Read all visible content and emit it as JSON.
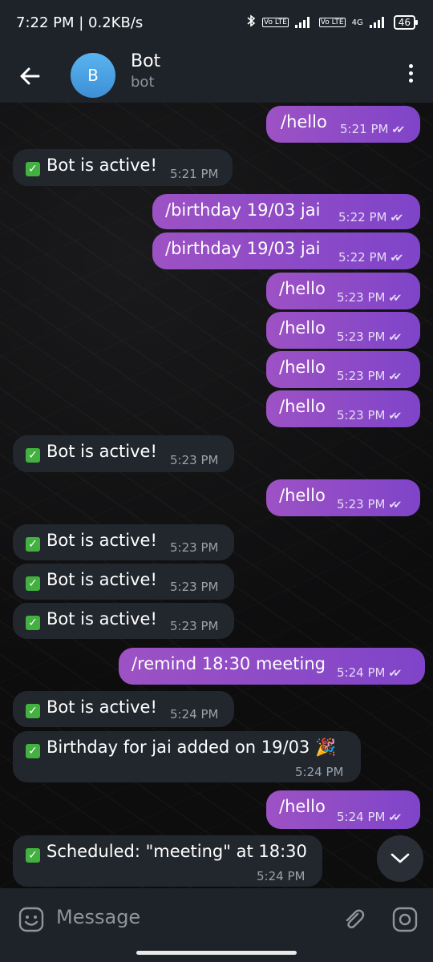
{
  "status_bar": {
    "time": "7:22 PM",
    "speed": "0.2KB/s",
    "net1": "Vo LTE",
    "net2": "Vo LTE",
    "net_type": "4G",
    "battery": "46"
  },
  "header": {
    "avatar_letter": "B",
    "title": "Bot",
    "subtitle": "bot"
  },
  "messages": [
    {
      "dir": "out",
      "text": "/hello",
      "time": "5:21 PM"
    },
    {
      "dir": "in",
      "text": "Bot is active!",
      "time": "5:21 PM"
    },
    {
      "dir": "out",
      "text": "/birthday 19/03 jai",
      "time": "5:22 PM"
    },
    {
      "dir": "out",
      "text": "/birthday 19/03 jai",
      "time": "5:22 PM"
    },
    {
      "dir": "out",
      "text": "/hello",
      "time": "5:23 PM"
    },
    {
      "dir": "out",
      "text": "/hello",
      "time": "5:23 PM"
    },
    {
      "dir": "out",
      "text": "/hello",
      "time": "5:23 PM"
    },
    {
      "dir": "out",
      "text": "/hello",
      "time": "5:23 PM"
    },
    {
      "dir": "in",
      "text": "Bot is active!",
      "time": "5:23 PM"
    },
    {
      "dir": "out",
      "text": "/hello",
      "time": "5:23 PM"
    },
    {
      "dir": "in",
      "text": "Bot is active!",
      "time": "5:23 PM"
    },
    {
      "dir": "in",
      "text": "Bot is active!",
      "time": "5:23 PM"
    },
    {
      "dir": "in",
      "text": "Bot is active!",
      "time": "5:23 PM"
    },
    {
      "dir": "out",
      "text": "/remind 18:30 meeting",
      "time": "5:24 PM"
    },
    {
      "dir": "in",
      "text": "Bot is active!",
      "time": "5:24 PM"
    },
    {
      "dir": "in",
      "text": "Birthday for jai added on 19/03 🎉",
      "time": "5:24 PM"
    },
    {
      "dir": "out",
      "text": "/hello",
      "time": "5:24 PM"
    },
    {
      "dir": "in",
      "text": "Scheduled: \"meeting\" at 18:30",
      "time": "5:24 PM"
    }
  ],
  "composer": {
    "placeholder": "Message"
  },
  "colors": {
    "outgoing_bubble": "#8a4bc6",
    "incoming_bubble": "#22272e",
    "check_green": "#43b140"
  }
}
